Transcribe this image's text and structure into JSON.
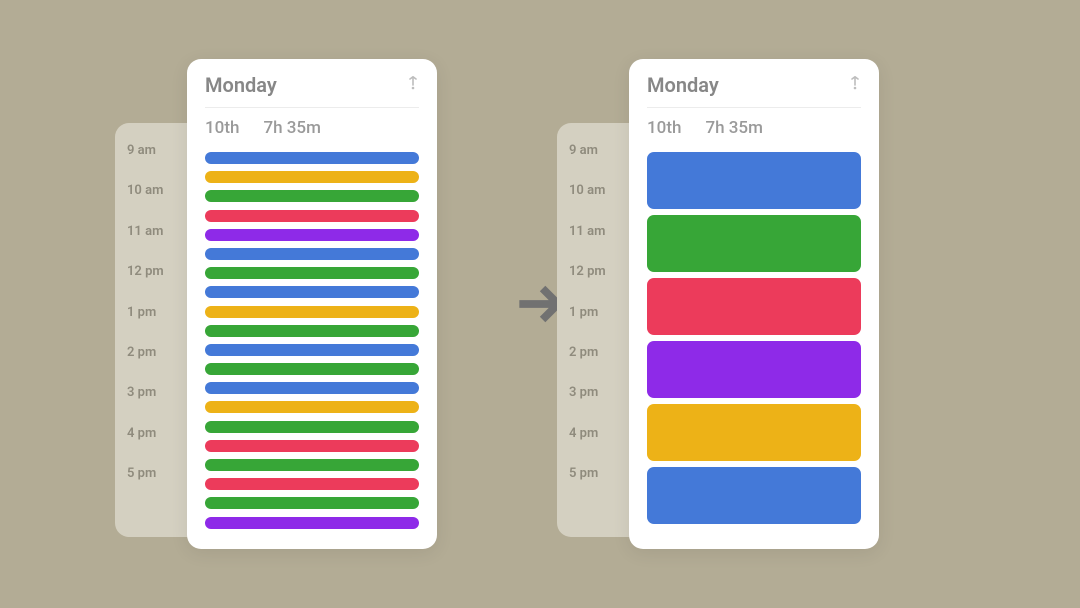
{
  "palette": {
    "blue": "#4479d8",
    "yellow": "#edb217",
    "green": "#37a637",
    "red": "#ec3b5b",
    "purple": "#8e2ae8"
  },
  "time_labels": [
    "9 am",
    "10 am",
    "11 am",
    "12 pm",
    "1 pm",
    "2 pm",
    "3 pm",
    "4 pm",
    "5 pm"
  ],
  "left_card": {
    "day": "Monday",
    "date": "10th",
    "total": "7h 35m",
    "events": [
      "blue",
      "yellow",
      "green",
      "red",
      "purple",
      "blue",
      "green",
      "blue",
      "yellow",
      "green",
      "blue",
      "green",
      "blue",
      "yellow",
      "green",
      "red",
      "green",
      "red",
      "green",
      "purple"
    ]
  },
  "right_card": {
    "day": "Monday",
    "date": "10th",
    "total": "7h 35m",
    "events": [
      "blue",
      "green",
      "red",
      "purple",
      "yellow",
      "blue"
    ]
  }
}
